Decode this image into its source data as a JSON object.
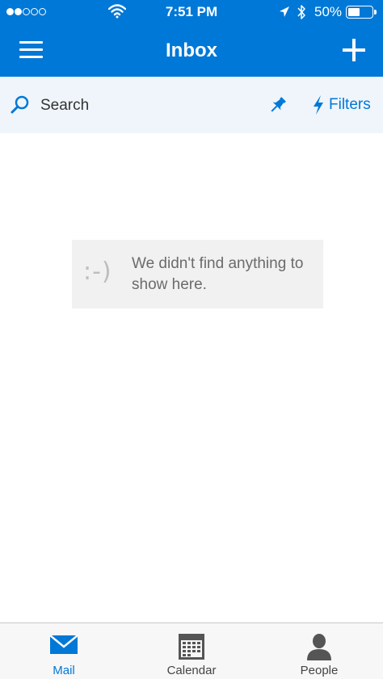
{
  "status_bar": {
    "time": "7:51 PM",
    "battery_percent": "50%",
    "battery_level": 0.5,
    "signal_bars": 2,
    "signal_total": 5,
    "icons": [
      "wifi-icon",
      "location-arrow-icon",
      "bluetooth-icon",
      "battery-icon"
    ]
  },
  "header": {
    "title": "Inbox",
    "menu_icon": "hamburger-menu-icon",
    "compose_icon": "plus-icon"
  },
  "search_bar": {
    "label": "Search",
    "search_icon": "search-icon",
    "pin_icon": "pin-icon",
    "filters_label": "Filters",
    "filters_icon": "lightning-bolt-icon"
  },
  "empty_state": {
    "face": ":-)",
    "message": "We didn't find anything to show here."
  },
  "tab_bar": {
    "tabs": [
      {
        "label": "Mail",
        "icon": "mail-icon",
        "active": true
      },
      {
        "label": "Calendar",
        "icon": "calendar-icon",
        "active": false
      },
      {
        "label": "People",
        "icon": "person-icon",
        "active": false
      }
    ]
  },
  "colors": {
    "accent": "#0078d7",
    "search_bar_bg": "#eff5fb",
    "empty_box_bg": "#f1f1f1",
    "tab_inactive": "#555555"
  }
}
